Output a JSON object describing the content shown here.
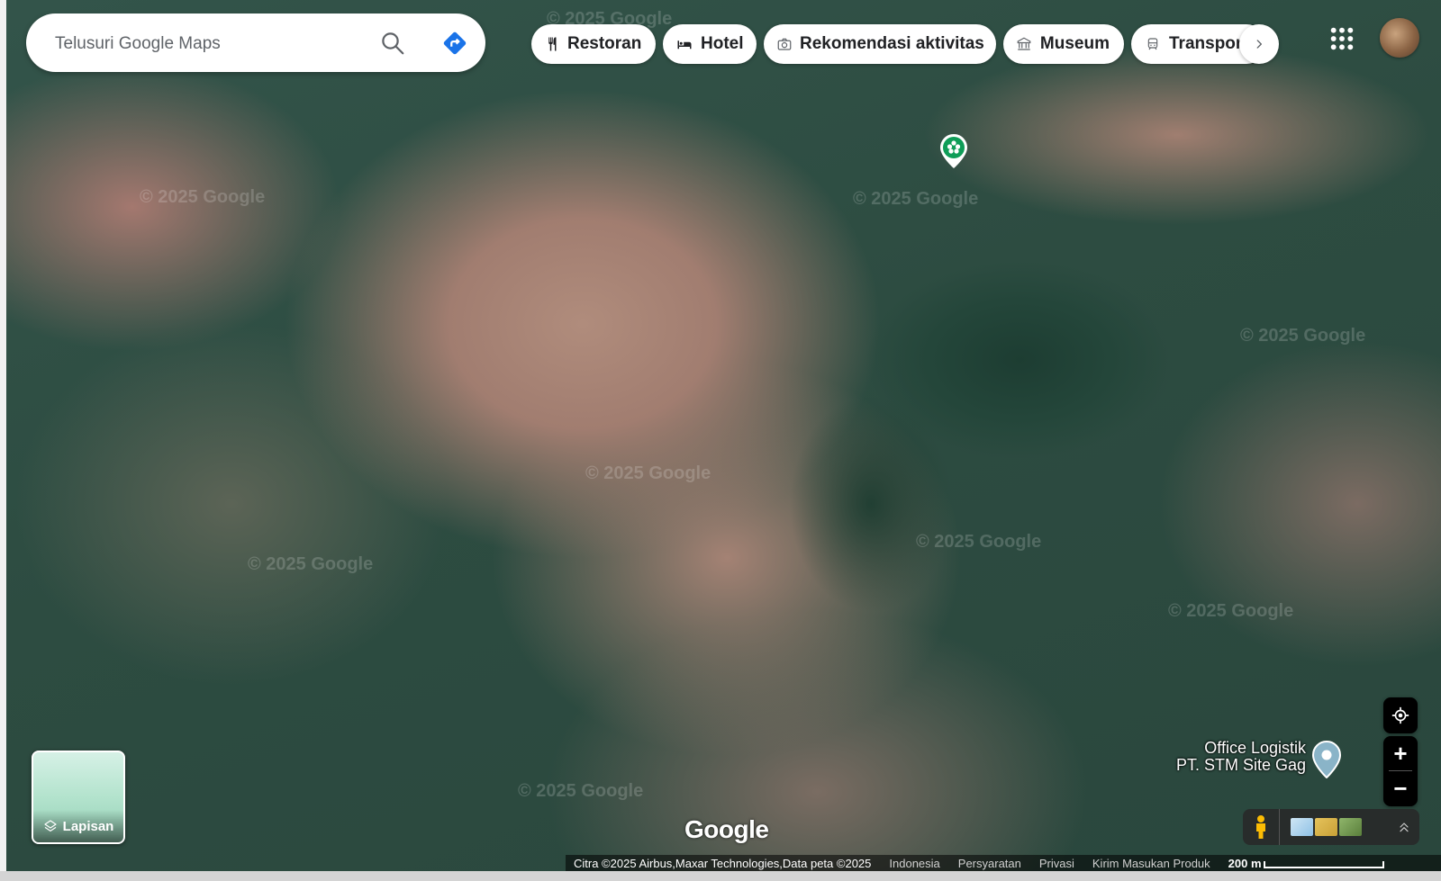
{
  "search": {
    "placeholder": "Telusuri Google Maps"
  },
  "chips": [
    {
      "label": "Restoran",
      "icon": "fork-knife-icon"
    },
    {
      "label": "Hotel",
      "icon": "bed-icon"
    },
    {
      "label": "Rekomendasi aktivitas",
      "icon": "camera-icon"
    },
    {
      "label": "Museum",
      "icon": "museum-icon"
    },
    {
      "label": "Transpor",
      "icon": "train-icon"
    }
  ],
  "map": {
    "watermark": "© 2025 Google",
    "place_label_line1": "Office Logistik",
    "place_label_line2": "PT. STM Site Gag",
    "brand": "Google"
  },
  "layers": {
    "label": "Lapisan"
  },
  "footer": {
    "imagery": "Citra ©2025 Airbus,Maxar Technologies,Data peta ©2025",
    "country": "Indonesia",
    "terms": "Persyaratan",
    "privacy": "Privasi",
    "feedback": "Kirim Masukan Produk",
    "scale": "200 m"
  },
  "colors": {
    "accent_blue": "#1a73e8",
    "pin_green": "#0f9d58"
  }
}
